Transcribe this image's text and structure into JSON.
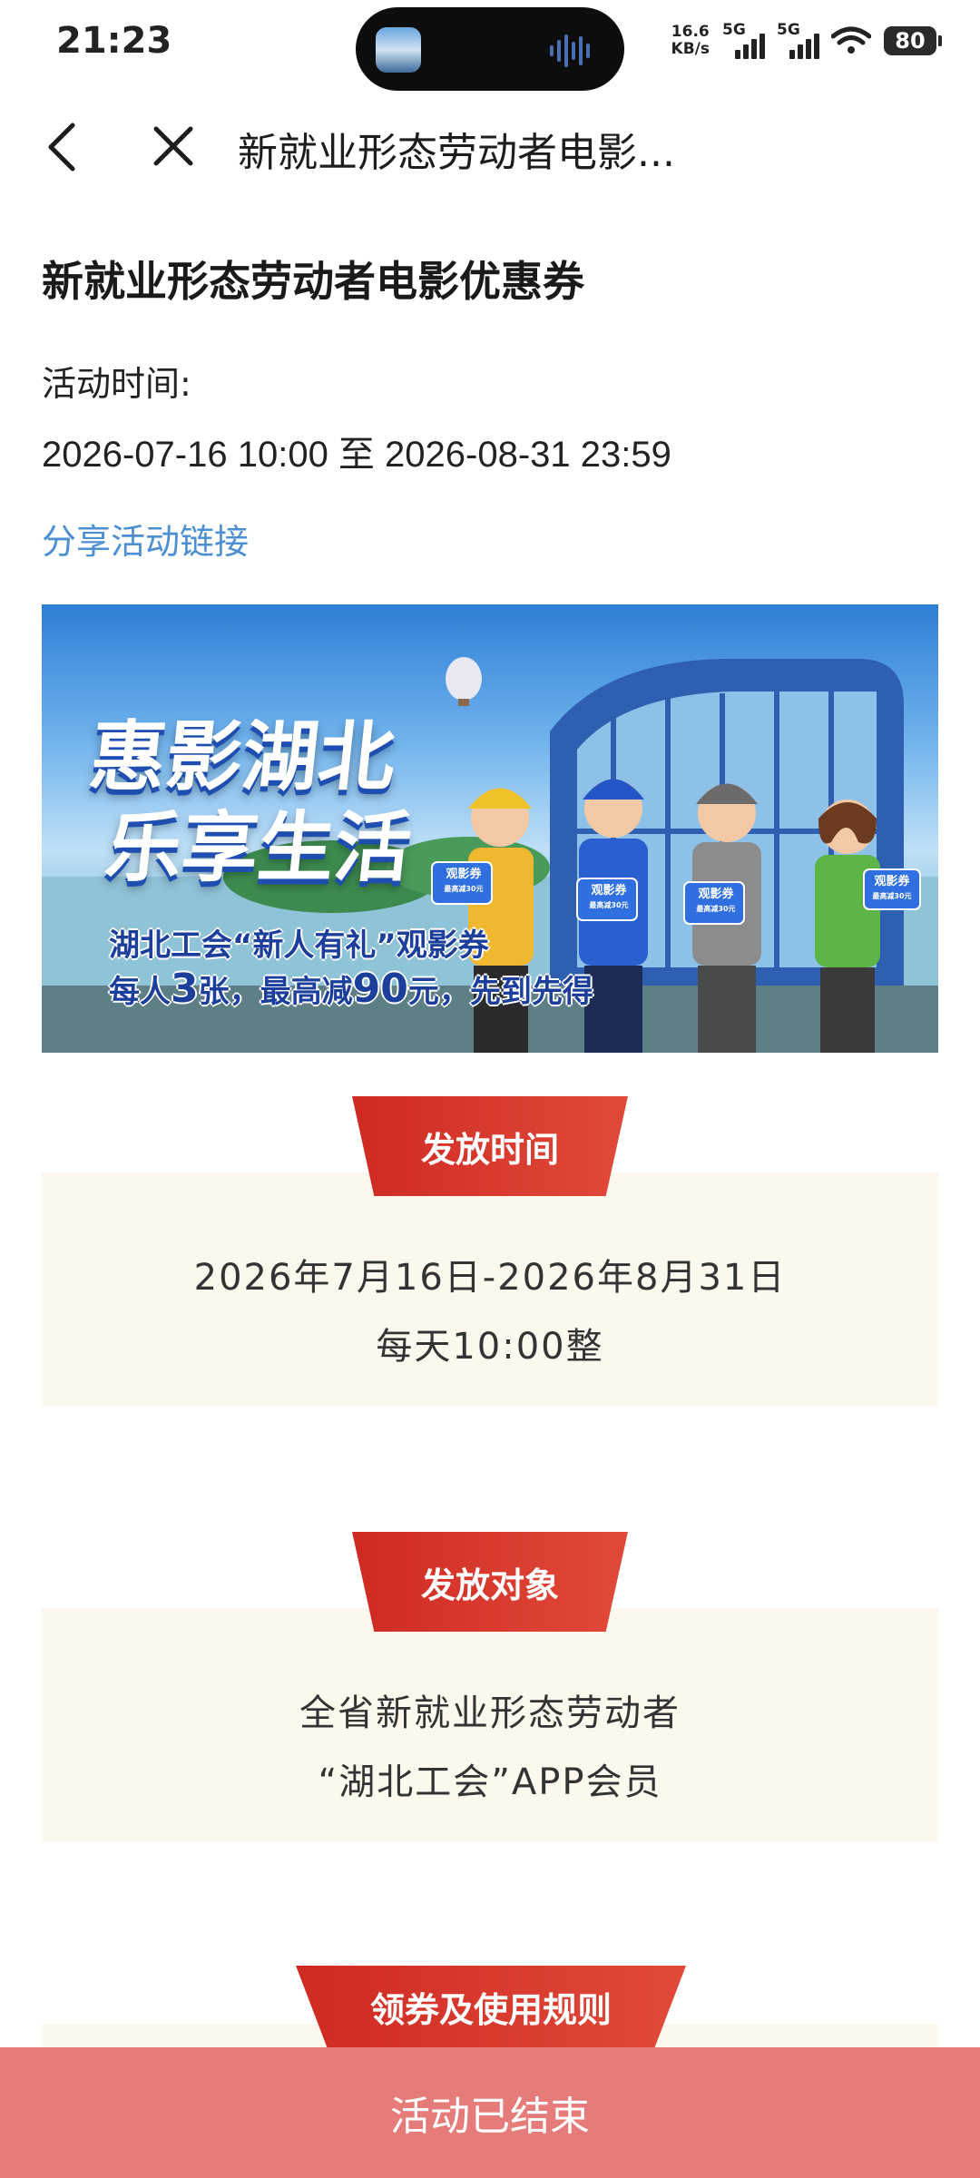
{
  "status_bar": {
    "time": "21:23",
    "net_speed_value": "16.6",
    "net_speed_unit": "KB/s",
    "signal1_tag": "5G",
    "signal2_tag": "5G",
    "battery": "80"
  },
  "nav": {
    "title": "新就业形态劳动者电影..."
  },
  "page": {
    "title": "新就业形态劳动者电影优惠券",
    "time_label": "活动时间:",
    "time_range": "2026-07-16 10:00 至 2026-08-31 23:59",
    "share_link": "分享活动链接"
  },
  "banner": {
    "headline_line1": "惠影湖北",
    "headline_line2": "乐享生活",
    "sub_line1": "湖北工会“新人有礼”观影券",
    "sub_line2_a": "每人",
    "sub_line2_num1": "3",
    "sub_line2_b": "张，最高减",
    "sub_line2_num2": "90",
    "sub_line2_c": "元，先到先得",
    "ticket_label": "观影券",
    "ticket_note": "最高减30元"
  },
  "sections": [
    {
      "tab": "发放时间",
      "lines": [
        "2026年7月16日-2026年8月31日",
        "每天10:00整"
      ]
    },
    {
      "tab": "发放对象",
      "lines": [
        "全省新就业形态劳动者",
        "“湖北工会”APP会员"
      ]
    },
    {
      "tab": "领券及使用规则",
      "lines": []
    }
  ],
  "bottom_bar": {
    "label": "活动已结束"
  },
  "colors": {
    "accent_red": "#d9352b",
    "link_blue": "#4d8fd3",
    "section_bg": "#fcf8ee",
    "bottom_bar": "#e57c7a"
  }
}
